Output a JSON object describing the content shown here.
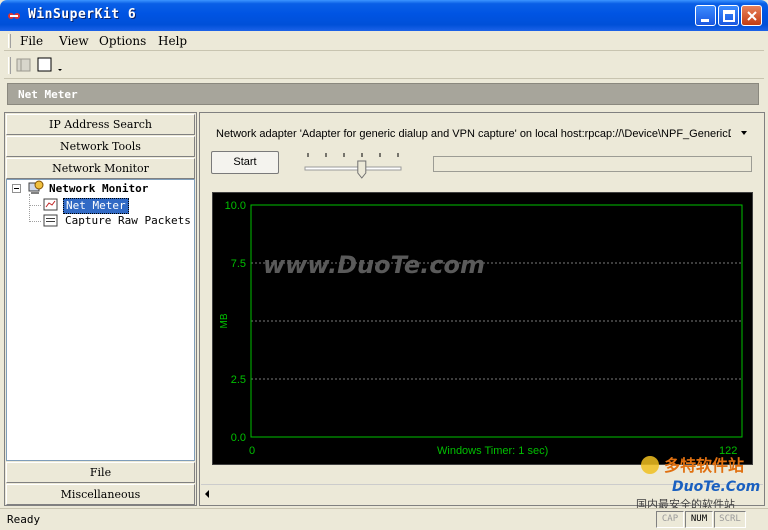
{
  "window": {
    "title": "WinSuperKit 6"
  },
  "menu": [
    "File",
    "View",
    "Options",
    "Help"
  ],
  "header": {
    "title": "Net Meter"
  },
  "nav_buttons_top": [
    "IP Address Search",
    "Network Tools",
    "Network Monitor"
  ],
  "tree": {
    "root": "Network Monitor",
    "children": [
      "Net Meter",
      "Capture Raw Packets"
    ],
    "selected": "Net Meter"
  },
  "nav_buttons_bottom": [
    "File",
    "Miscellaneous"
  ],
  "monitor": {
    "adapter": "Network adapter 'Adapter for generic dialup and VPN capture' on local host:rpcap://\\Device\\NPF_GenericDi",
    "start_label": "Start",
    "slider_fraction": 0.6
  },
  "chart_data": {
    "type": "line",
    "ylabel": "MB",
    "xlabel": "Windows Timer: 1 sec)",
    "yticks": [
      "10.0",
      "7.5",
      "2.5",
      "0.0"
    ],
    "ytick_values": [
      10.0,
      7.5,
      2.5,
      0.0
    ],
    "gridlines": [
      7.5,
      5.0,
      2.5
    ],
    "xlim": [
      0,
      122
    ],
    "xtick_labels": [
      "0",
      "122"
    ],
    "ylim": [
      0,
      10
    ],
    "series": [],
    "colors": {
      "background": "#000000",
      "axis": "#00c000",
      "grid": "#7a7a7a",
      "text": "#00c000"
    }
  },
  "watermark": {
    "text": "www.DuoTe.com",
    "logo_line1": "多特软件站",
    "logo_line2": "DuoTe.Com",
    "logo_line3": "国内最安全的软件站"
  },
  "status": {
    "text": "Ready",
    "indicators": [
      {
        "label": "CAP",
        "active": false
      },
      {
        "label": "NUM",
        "active": true
      },
      {
        "label": "SCRL",
        "active": false
      }
    ]
  }
}
